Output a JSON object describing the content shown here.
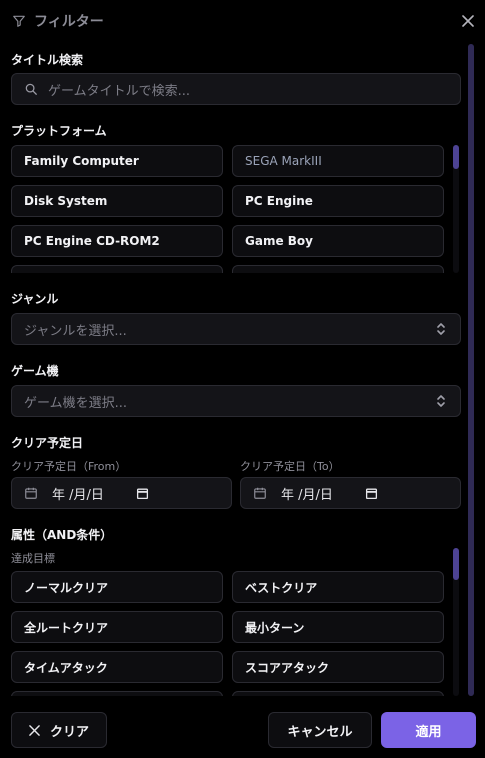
{
  "header": {
    "title": "フィルター",
    "filter_icon": "filter-icon",
    "close_icon": "close-icon"
  },
  "title_search": {
    "label": "タイトル検索",
    "placeholder": "ゲームタイトルで検索..."
  },
  "platform": {
    "label": "プラットフォーム",
    "items": [
      {
        "label": "Family Computer",
        "selected": false
      },
      {
        "label": "SEGA MarkIII",
        "selected": false,
        "muted": true
      },
      {
        "label": "Disk System",
        "selected": false
      },
      {
        "label": "PC Engine",
        "selected": false
      },
      {
        "label": "PC Engine CD-ROM2",
        "selected": false
      },
      {
        "label": "Game Boy",
        "selected": false
      }
    ]
  },
  "genre": {
    "label": "ジャンル",
    "placeholder": "ジャンルを選択..."
  },
  "console": {
    "label": "ゲーム機",
    "placeholder": "ゲーム機を選択..."
  },
  "clear_date": {
    "label": "クリア予定日",
    "from_label": "クリア予定日（From）",
    "to_label": "クリア予定日（To）",
    "from_value": "年 /月/日",
    "to_value": "年 /月/日"
  },
  "attributes": {
    "label": "属性（AND条件）",
    "sub_label": "達成目標",
    "items": [
      {
        "label": "ノーマルクリア"
      },
      {
        "label": "ベストクリア"
      },
      {
        "label": "全ルートクリア"
      },
      {
        "label": "最小ターン"
      },
      {
        "label": "タイムアタック"
      },
      {
        "label": "スコアアタック"
      }
    ]
  },
  "footer": {
    "clear_label": "クリア",
    "cancel_label": "キャンセル",
    "apply_label": "適用"
  },
  "colors": {
    "accent": "#7b63e6",
    "background": "#000000",
    "field": "#141418",
    "border": "#2a2a31"
  }
}
